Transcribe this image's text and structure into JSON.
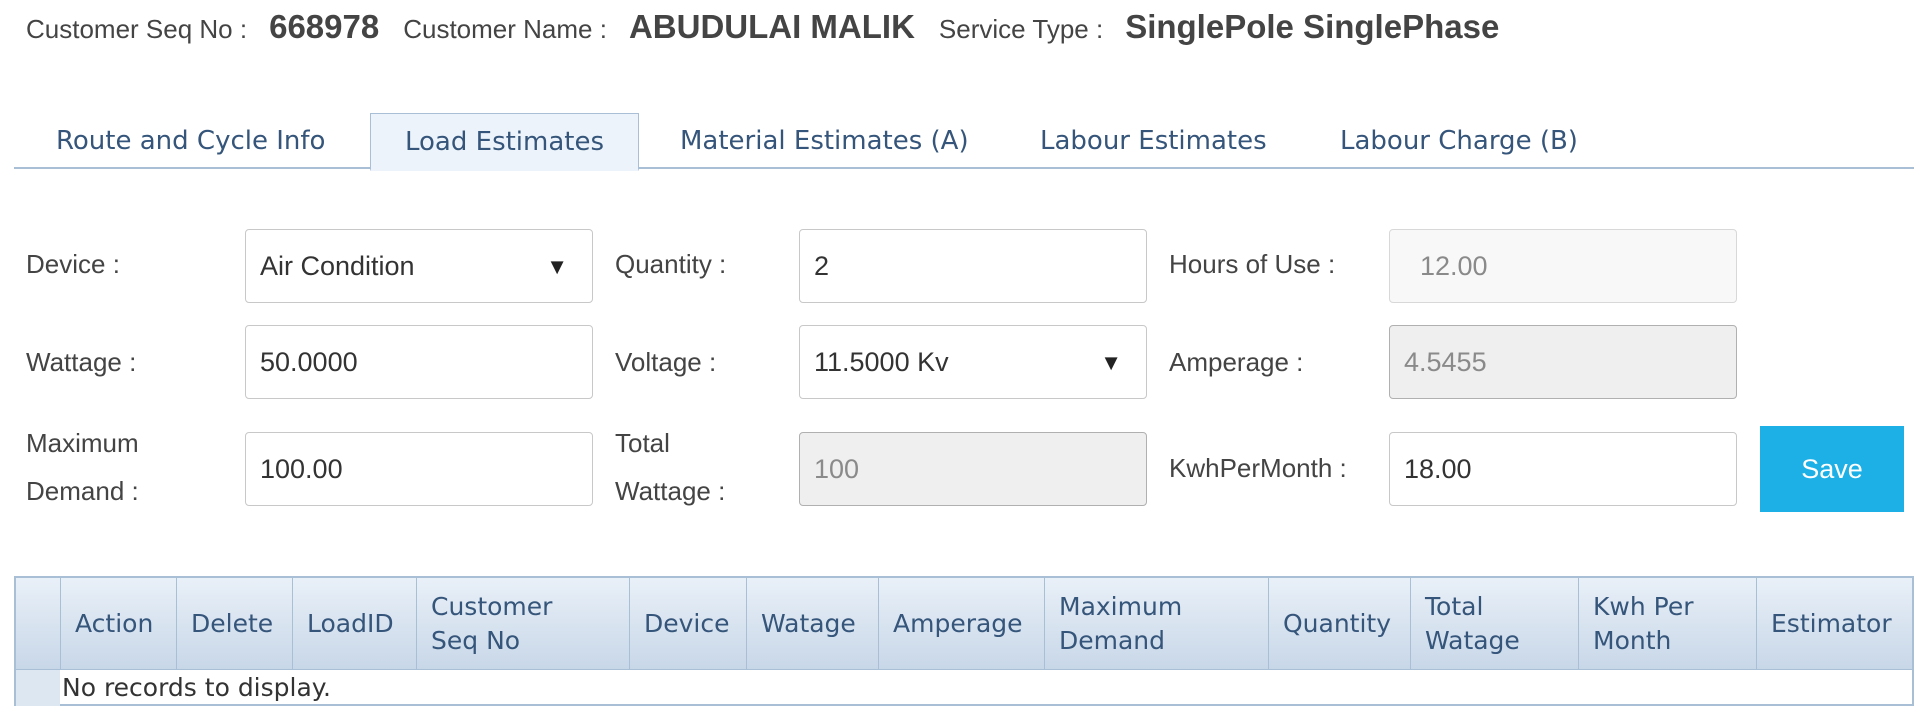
{
  "header": {
    "seq_label": "Customer Seq No :",
    "seq_value": "668978",
    "name_label": "Customer Name :",
    "name_value": "ABUDULAI MALIK",
    "service_label": "Service Type :",
    "service_value": "SinglePole SinglePhase"
  },
  "tabs": [
    {
      "label": "Route and Cycle Info"
    },
    {
      "label": "Load Estimates"
    },
    {
      "label": "Material Estimates (A)"
    },
    {
      "label": "Labour Estimates"
    },
    {
      "label": "Labour Charge (B)"
    }
  ],
  "active_tab": "Load Estimates",
  "form": {
    "device_label": "Device :",
    "device_value": "Air Condition",
    "quantity_label": "Quantity :",
    "quantity_value": "2",
    "hours_label": "Hours of Use :",
    "hours_value": "12.00",
    "wattage_label": "Wattage :",
    "wattage_value": "50.0000",
    "voltage_label": "Voltage :",
    "voltage_value": "11.5000 Kv",
    "amperage_label": "Amperage :",
    "amperage_value": "4.5455",
    "max_demand_label_1": "Maximum",
    "max_demand_label_2": "Demand :",
    "max_demand_value": "100.00",
    "total_wattage_label_1": "Total",
    "total_wattage_label_2": "Wattage :",
    "total_wattage_value": "100",
    "kwh_label": "KwhPerMonth :",
    "kwh_value": "18.00",
    "save_label": "Save"
  },
  "grid": {
    "columns": [
      {
        "line1": "Action",
        "line2": ""
      },
      {
        "line1": "Delete",
        "line2": ""
      },
      {
        "line1": "LoadID",
        "line2": ""
      },
      {
        "line1": "Customer",
        "line2": "Seq No"
      },
      {
        "line1": "Device",
        "line2": ""
      },
      {
        "line1": "Watage",
        "line2": ""
      },
      {
        "line1": "Amperage",
        "line2": ""
      },
      {
        "line1": "Maximum",
        "line2": "Demand"
      },
      {
        "line1": "Quantity",
        "line2": ""
      },
      {
        "line1": "Total",
        "line2": "Watage"
      },
      {
        "line1": "Kwh Per",
        "line2": "Month"
      },
      {
        "line1": "Estimator",
        "line2": ""
      }
    ],
    "empty_message": "No records to display."
  },
  "colors": {
    "accent": "#1cb0e6",
    "tab_text": "#35557a",
    "border": "#a9bfd6"
  },
  "icons": {
    "dropdown": "chevron-down-icon"
  }
}
